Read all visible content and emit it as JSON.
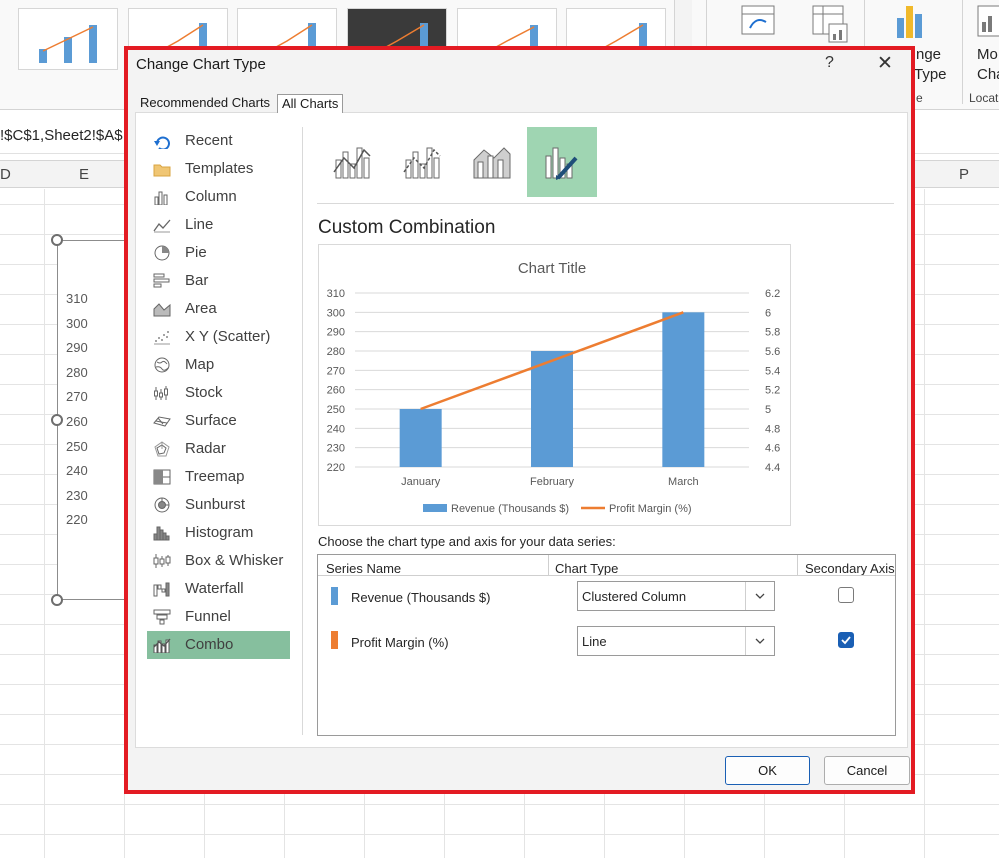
{
  "ribbon": {
    "right_button_1": "nge",
    "right_button_1b": "Type",
    "right_group_1": "e",
    "right_button_2": "Mo",
    "right_button_2b": "Cha",
    "right_group_2": "Locat"
  },
  "formula_bar": {
    "text": "!$C$1,Sheet2!$A$"
  },
  "columns": {
    "d": "D",
    "e": "E",
    "p": "P"
  },
  "sheet_chart": {
    "ticks": [
      "310",
      "300",
      "290",
      "280",
      "270",
      "260",
      "250",
      "240",
      "230",
      "220"
    ]
  },
  "dialog": {
    "title": "Change Chart Type",
    "help": "?",
    "close": "✕",
    "tabs": [
      "Recommended Charts",
      "All Charts"
    ],
    "chart_types": [
      {
        "label": "Recent",
        "icon": "recent-icon"
      },
      {
        "label": "Templates",
        "icon": "folder-icon"
      },
      {
        "label": "Column",
        "icon": "column-chart-icon"
      },
      {
        "label": "Line",
        "icon": "line-chart-icon"
      },
      {
        "label": "Pie",
        "icon": "pie-chart-icon"
      },
      {
        "label": "Bar",
        "icon": "bar-chart-icon"
      },
      {
        "label": "Area",
        "icon": "area-chart-icon"
      },
      {
        "label": "X Y (Scatter)",
        "icon": "scatter-chart-icon"
      },
      {
        "label": "Map",
        "icon": "map-chart-icon"
      },
      {
        "label": "Stock",
        "icon": "stock-chart-icon"
      },
      {
        "label": "Surface",
        "icon": "surface-chart-icon"
      },
      {
        "label": "Radar",
        "icon": "radar-chart-icon"
      },
      {
        "label": "Treemap",
        "icon": "treemap-chart-icon"
      },
      {
        "label": "Sunburst",
        "icon": "sunburst-chart-icon"
      },
      {
        "label": "Histogram",
        "icon": "histogram-chart-icon"
      },
      {
        "label": "Box & Whisker",
        "icon": "box-whisker-chart-icon"
      },
      {
        "label": "Waterfall",
        "icon": "waterfall-chart-icon"
      },
      {
        "label": "Funnel",
        "icon": "funnel-chart-icon"
      },
      {
        "label": "Combo",
        "icon": "combo-chart-icon"
      }
    ],
    "selected_type": "Combo",
    "subtype_title": "Custom Combination",
    "choose_label": "Choose the chart type and axis for your data series:",
    "table_headers": {
      "series": "Series Name",
      "type": "Chart Type",
      "axis": "Secondary Axis"
    },
    "series": [
      {
        "name": "Revenue (Thousands $)",
        "chart_type": "Clustered Column",
        "secondary_axis": false,
        "color": "#5b9bd5"
      },
      {
        "name": "Profit Margin (%)",
        "chart_type": "Line",
        "secondary_axis": true,
        "color": "#ed7d31"
      }
    ],
    "ok_label": "OK",
    "cancel_label": "Cancel",
    "highlight_color": "#e31b23",
    "selection_color": "#86bf9e"
  },
  "chart_data": {
    "type": "bar",
    "title": "Chart Title",
    "categories": [
      "January",
      "February",
      "March"
    ],
    "series": [
      {
        "name": "Revenue (Thousands $)",
        "type": "bar",
        "axis": "primary",
        "values": [
          250,
          280,
          300
        ],
        "color": "#5b9bd5"
      },
      {
        "name": "Profit Margin (%)",
        "type": "line",
        "axis": "secondary",
        "values": [
          5.0,
          5.5,
          6.0
        ],
        "color": "#ed7d31"
      }
    ],
    "ylim": [
      220,
      310
    ],
    "y_ticks": [
      "310",
      "300",
      "290",
      "280",
      "270",
      "260",
      "250",
      "240",
      "230",
      "220"
    ],
    "y2lim": [
      4.4,
      6.2
    ],
    "y2_ticks": [
      "6.2",
      "6",
      "5.8",
      "5.6",
      "5.4",
      "5.2",
      "5",
      "4.8",
      "4.6",
      "4.4"
    ],
    "grid": true,
    "legend": "bottom"
  }
}
